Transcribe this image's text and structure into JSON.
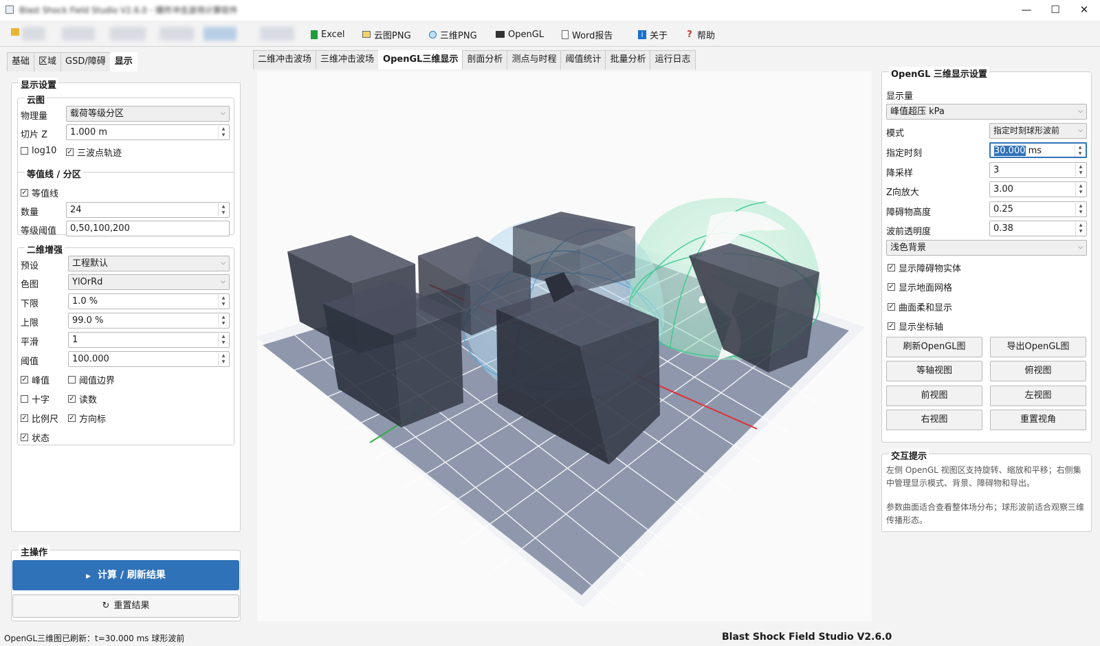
{
  "window": {
    "title": "Blast Shock Field Studio V2.6.0 - 爆炸冲击波场计算软件",
    "minimize": "—",
    "maximize": "☐",
    "close": "✕"
  },
  "toolbar": {
    "excel": "Excel",
    "cloud_png": "云图PNG",
    "three_d_png": "三维PNG",
    "opengl": "OpenGL",
    "word_report": "Word报告",
    "about": "关于",
    "help": "帮助"
  },
  "left_tabs": [
    "基础",
    "区域",
    "GSD/障碍",
    "显示"
  ],
  "display_settings": {
    "title": "显示设置",
    "cloud": {
      "title": "云图",
      "physical_label": "物理量",
      "physical_value": "载荷等级分区",
      "slice_label": "切片 Z",
      "slice_value": "1.000 m",
      "log10": "log10",
      "triple_point": "三波点轨迹"
    },
    "contour": {
      "title": "等值线 / 分区",
      "contour_chk": "等值线",
      "count_label": "数量",
      "count_value": "24",
      "level_label": "等级阈值",
      "level_value": "0,50,100,200"
    },
    "enhance": {
      "title": "二维增强",
      "preset_label": "预设",
      "preset_value": "工程默认",
      "cmap_label": "色图",
      "cmap_value": "YlOrRd",
      "lower_label": "下限",
      "lower_value": "1.0 %",
      "upper_label": "上限",
      "upper_value": "99.0 %",
      "smooth_label": "平滑",
      "smooth_value": "1",
      "threshold_label": "阈值",
      "threshold_value": "100.000",
      "peak": "峰值",
      "thr_border": "阈值边界",
      "cross": "十字",
      "readout": "读数",
      "scale_bar": "比例尺",
      "north_arrow": "方向标",
      "status": "状态"
    }
  },
  "main_ops": {
    "title": "主操作",
    "compute": "计算 / 刷新结果",
    "reset": "重置结果"
  },
  "view_tabs": [
    "二维冲击波场",
    "三维冲击波场",
    "OpenGL三维显示",
    "剖面分析",
    "测点与时程",
    "阈值统计",
    "批量分析",
    "运行日志"
  ],
  "opengl_settings": {
    "title": "OpenGL 三维显示设置",
    "qty_label": "显示量",
    "qty_value": "峰值超压 kPa",
    "mode_label": "模式",
    "mode_value": "指定时刻球形波前",
    "time_label": "指定时刻",
    "time_value": "30.000",
    "time_unit": "ms",
    "downsample_label": "降采样",
    "downsample_value": "3",
    "zscale_label": "Z向放大",
    "zscale_value": "3.00",
    "obst_h_label": "障碍物高度",
    "obst_h_value": "0.25",
    "front_alpha_label": "波前透明度",
    "front_alpha_value": "0.38",
    "background_value": "浅色背景",
    "show_obstacles": "显示障碍物实体",
    "show_grid": "显示地面网格",
    "smooth_surface": "曲面柔和显示",
    "show_axes": "显示坐标轴",
    "refresh": "刷新OpenGL图",
    "export": "导出OpenGL图",
    "iso": "等轴视图",
    "top": "俯视图",
    "front": "前视图",
    "left": "左视图",
    "right": "右视图",
    "reset_view": "重置视角"
  },
  "hints": {
    "title": "交互提示",
    "line1": "左侧 OpenGL 视图区支持旋转、缩放和平移；右侧集中管理显示模式、背景、障碍物和导出。",
    "line2": "参数曲面适合查看整体场分布；球形波前适合观察三维传播形态。"
  },
  "status": {
    "left": "OpenGL三维图已刷新：t=30.000 ms 球形波前",
    "right": "Blast Shock Field Studio V2.6.0"
  },
  "colors": {
    "accent": "#2f72b8",
    "wave_blue": "#4aa8e0",
    "wave_green": "#35c98a",
    "axis_red": "#e03030",
    "axis_green": "#30b040"
  }
}
